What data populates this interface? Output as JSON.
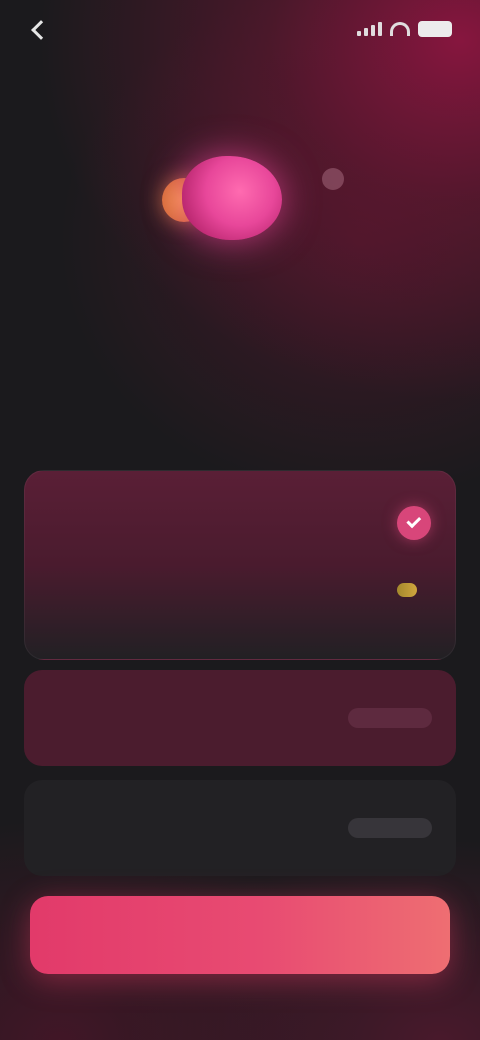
{
  "status_bar": {
    "back_label": ""
  },
  "hero": {
    "eyebrow": "",
    "icon": "hearts-blob-icon",
    "headline": "",
    "subtext": ""
  },
  "plan": {
    "title": "",
    "selected": true,
    "name": "",
    "description": "",
    "badge": "",
    "price": "",
    "period": ""
  },
  "options": [
    {
      "label": "",
      "sub": "",
      "price": "",
      "per": ""
    },
    {
      "label": "",
      "sub": "",
      "price": "",
      "per": ""
    }
  ],
  "cta": {
    "label": ""
  },
  "colors": {
    "accent": "#e23a6a",
    "accent_end": "#ee6e72",
    "card_selected": "#4b1c2e",
    "card_default": "#222124",
    "badge_gold": "#c9a23c",
    "background": "#1b1a1d"
  }
}
